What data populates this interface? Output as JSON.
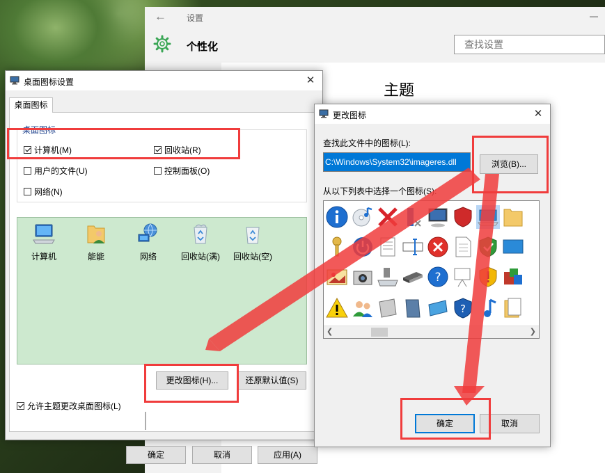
{
  "settings": {
    "window_title": "设置",
    "section_title": "个性化",
    "search_placeholder": "查找设置",
    "content_title": "主题"
  },
  "desktop_icon_dialog": {
    "title": "桌面图标设置",
    "tab_label": "桌面图标",
    "group_label": "桌面图标",
    "checkboxes": [
      {
        "label": "计算机(M)",
        "checked": true
      },
      {
        "label": "回收站(R)",
        "checked": true
      },
      {
        "label": "用户的文件(U)",
        "checked": false
      },
      {
        "label": "控制面板(O)",
        "checked": false
      },
      {
        "label": "网络(N)",
        "checked": false
      }
    ],
    "icons": [
      {
        "label": "计算机",
        "icon": "computer-icon"
      },
      {
        "label": "能能",
        "icon": "user-folder-icon"
      },
      {
        "label": "网络",
        "icon": "network-icon"
      },
      {
        "label": "回收站(满)",
        "icon": "recycle-bin-full-icon"
      },
      {
        "label": "回收站(空)",
        "icon": "recycle-bin-empty-icon"
      }
    ],
    "change_icon_button": "更改图标(H)...",
    "restore_default_button": "还原默认值(S)",
    "allow_theme_label": "允许主题更改桌面图标(L)",
    "allow_theme_checked": true,
    "ok_button": "确定",
    "cancel_button": "取消",
    "apply_button": "应用(A)"
  },
  "change_icon_dialog": {
    "title": "更改图标",
    "find_label": "查找此文件中的图标(L):",
    "path_value": "C:\\Windows\\System32\\imageres.dll",
    "browse_button": "浏览(B)...",
    "select_label": "从以下列表中选择一个图标(S):",
    "ok_button": "确定",
    "cancel_button": "取消"
  },
  "colors": {
    "accent": "#0078d7",
    "annotation_red": "#f03c3c",
    "icon_area_bg": "#cde9cf"
  }
}
